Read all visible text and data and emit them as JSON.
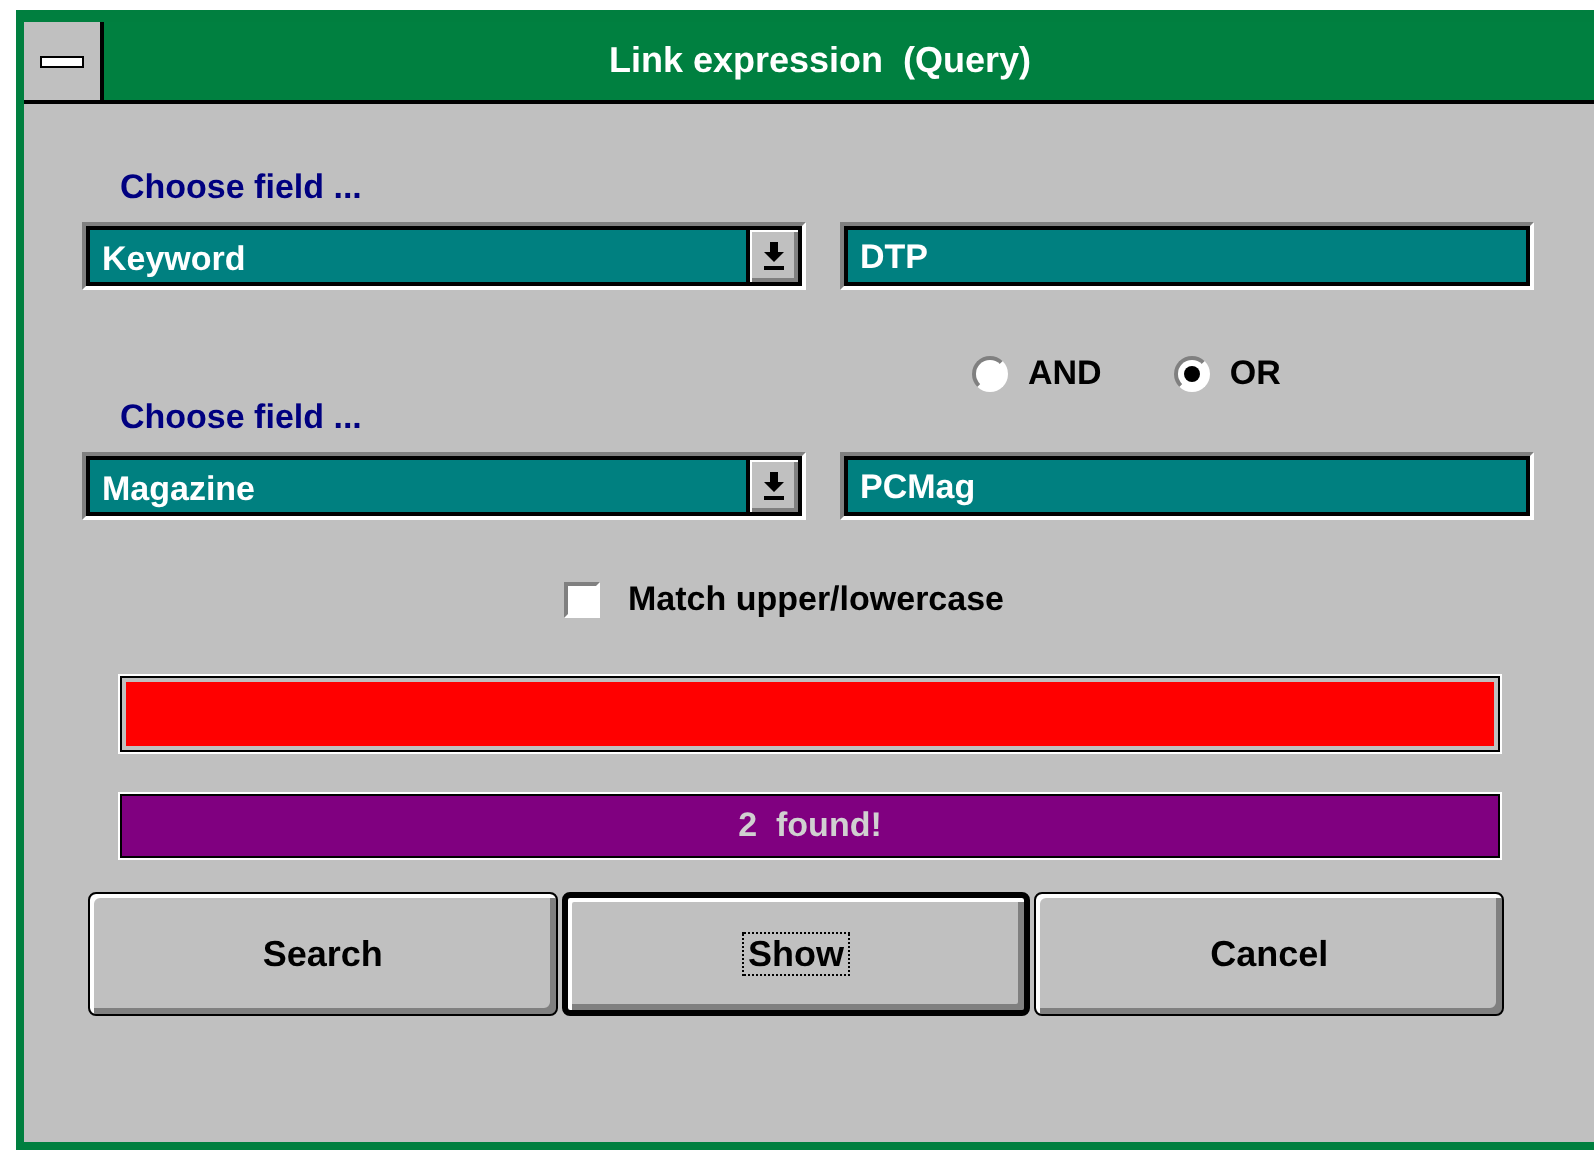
{
  "window": {
    "title": "Link expression  (Query)"
  },
  "conditions": [
    {
      "label": "Choose field ...",
      "field": "Keyword",
      "value": "DTP"
    },
    {
      "label": "Choose field ...",
      "field": "Magazine",
      "value": "PCMag"
    }
  ],
  "operators": [
    {
      "label": "AND",
      "selected": false
    },
    {
      "label": "OR",
      "selected": true
    }
  ],
  "match_case": {
    "label": "Match upper/lowercase",
    "checked": false
  },
  "progress": {
    "level": 1
  },
  "status": "2  found!",
  "buttons": [
    {
      "label": "Search",
      "default": false,
      "focused": false
    },
    {
      "label": "Show",
      "default": true,
      "focused": true
    },
    {
      "label": "Cancel",
      "default": false,
      "focused": false
    }
  ]
}
